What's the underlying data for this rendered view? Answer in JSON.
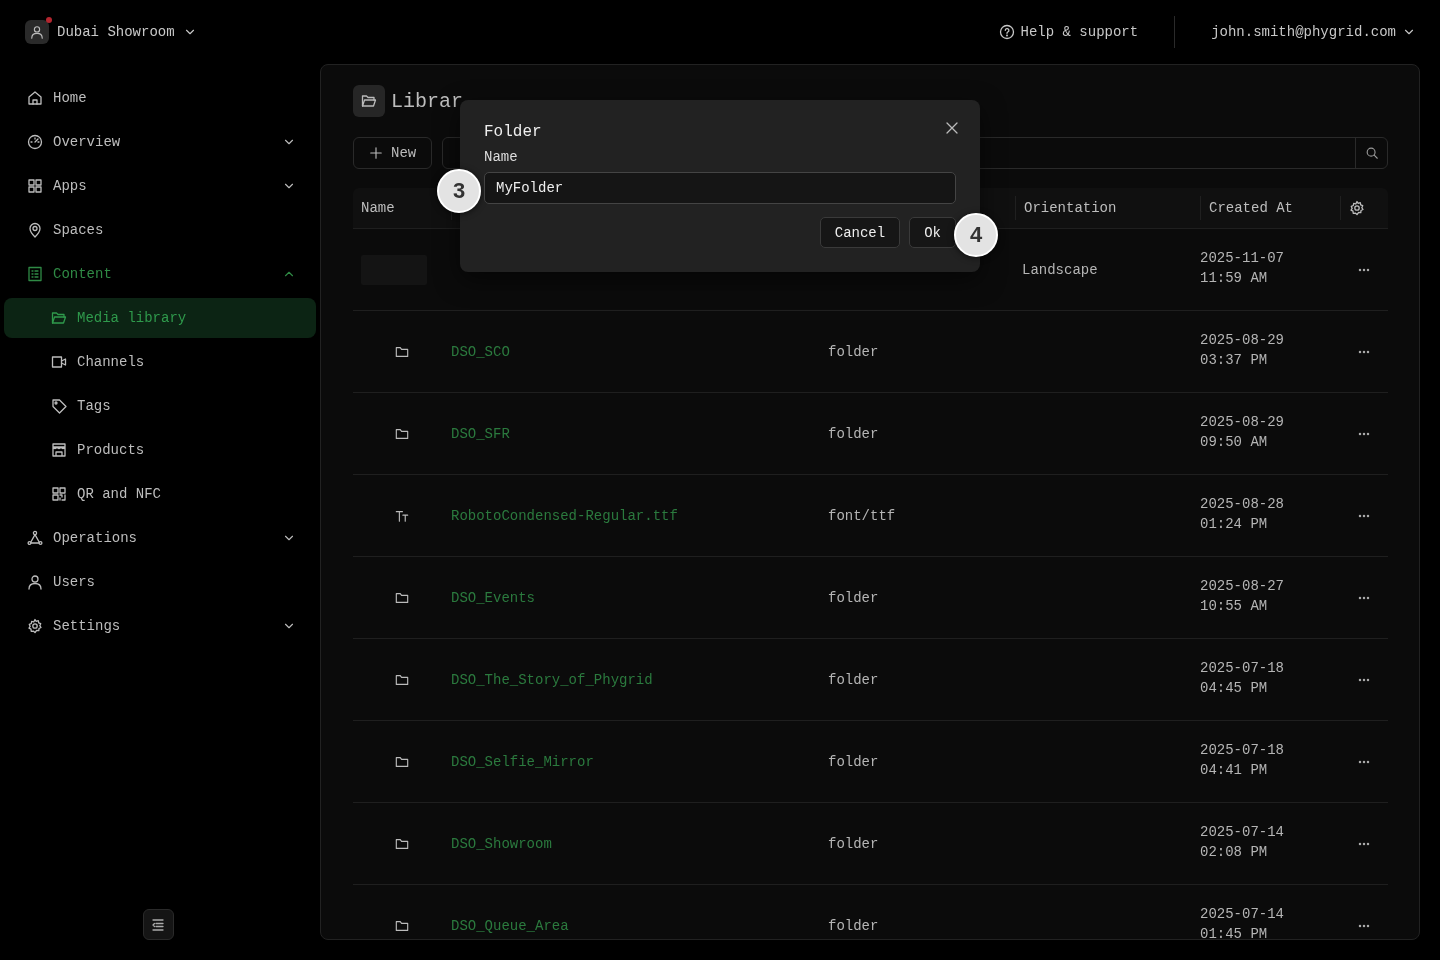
{
  "topbar": {
    "workspace": "Dubai Showroom",
    "help": "Help & support",
    "user": "john.smith@phygrid.com"
  },
  "sidebar": {
    "items": [
      {
        "label": "Home",
        "selected": false
      },
      {
        "label": "Overview",
        "selected": false,
        "expanded": false
      },
      {
        "label": "Apps",
        "selected": false,
        "expanded": false
      },
      {
        "label": "Spaces",
        "selected": false
      },
      {
        "label": "Content",
        "selected": false,
        "expanded": true,
        "children": [
          {
            "label": "Media library",
            "selected": true
          },
          {
            "label": "Channels",
            "selected": false
          },
          {
            "label": "Tags",
            "selected": false
          },
          {
            "label": "Products",
            "selected": false
          },
          {
            "label": "QR and NFC",
            "selected": false
          }
        ]
      },
      {
        "label": "Operations",
        "selected": false,
        "expanded": false
      },
      {
        "label": "Users",
        "selected": false
      },
      {
        "label": "Settings",
        "selected": false,
        "expanded": false
      }
    ]
  },
  "library": {
    "title": "Librar",
    "new_button": "New",
    "table": {
      "columns": [
        "Name",
        "Orientation",
        "Created At"
      ],
      "rows": [
        {
          "kind": "image",
          "orientation": "Landscape",
          "created": "2025-11-07 11:59 AM"
        },
        {
          "kind": "folder",
          "name": "DSO_SCO",
          "type": "folder",
          "created": "2025-08-29 03:37 PM"
        },
        {
          "kind": "folder",
          "name": "DSO_SFR",
          "type": "folder",
          "created": "2025-08-29 09:50 AM"
        },
        {
          "kind": "font",
          "name": "RobotoCondensed-Regular.ttf",
          "type": "font/ttf",
          "created": "2025-08-28 01:24 PM"
        },
        {
          "kind": "folder",
          "name": "DSO_Events",
          "type": "folder",
          "created": "2025-08-27 10:55 AM"
        },
        {
          "kind": "folder",
          "name": "DSO_The_Story_of_Phygrid",
          "type": "folder",
          "created": "2025-07-18 04:45 PM"
        },
        {
          "kind": "folder",
          "name": "DSO_Selfie_Mirror",
          "type": "folder",
          "created": "2025-07-18 04:41 PM"
        },
        {
          "kind": "folder",
          "name": "DSO_Showroom",
          "type": "folder",
          "created": "2025-07-14 02:08 PM"
        },
        {
          "kind": "folder",
          "name": "DSO_Queue_Area",
          "type": "folder",
          "created": "2025-07-14 01:45 PM"
        }
      ]
    }
  },
  "dialog": {
    "title": "Folder",
    "field_label": "Name",
    "value": "MyFolder",
    "buttons": [
      "Cancel",
      "Ok"
    ]
  },
  "annotations": [
    "3",
    "4"
  ]
}
